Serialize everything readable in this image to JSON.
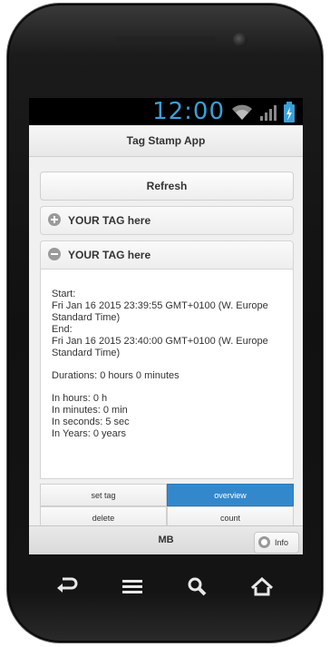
{
  "status_bar": {
    "time": "12:00"
  },
  "app": {
    "title": "Tag Stamp App"
  },
  "refresh": {
    "label": "Refresh"
  },
  "tags": [
    {
      "label": "YOUR TAG here",
      "state": "collapsed"
    },
    {
      "label": "YOUR TAG here",
      "state": "expanded"
    }
  ],
  "details": {
    "start_label": "Start:",
    "start_value_1": "Fri Jan 16 2015 23:39:55 GMT+0100 (W. Europe",
    "start_value_2": "Standard Time)",
    "end_label": "End:",
    "end_value_1": "Fri Jan 16 2015 23:40:00 GMT+0100 (W. Europe",
    "end_value_2": "Standard Time)",
    "duration": "Durations: 0 hours 0 minutes",
    "in_hours": "In hours: 0 h",
    "in_minutes": "In minutes: 0 min",
    "in_seconds": "In seconds: 5 sec",
    "in_years": "In Years: 0 years"
  },
  "actions": {
    "set_tag": "set tag",
    "overview": "overview",
    "delete": "delete",
    "count": "count"
  },
  "footer": {
    "title": "MB",
    "info_label": "Info"
  },
  "colors": {
    "accent": "#3388cc",
    "clock": "#3aa0d8"
  }
}
